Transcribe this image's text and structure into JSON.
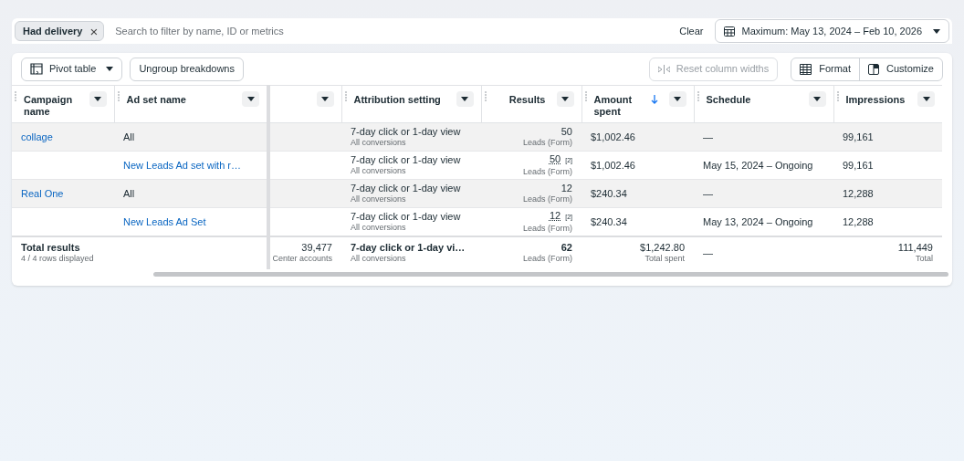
{
  "filter_bar": {
    "chip": {
      "label": "Had delivery",
      "remove": "×"
    },
    "search": {
      "placeholder": "Search to filter by name, ID or metrics"
    },
    "clear": "Clear",
    "date_range": "Maximum: May 13, 2024 – Feb 10, 2026"
  },
  "toolbar": {
    "left": [
      {
        "label": "Pivot table",
        "dropdown": true,
        "disabled": false
      },
      {
        "label": "Ungroup breakdowns",
        "dropdown": false,
        "disabled": false
      }
    ],
    "right": [
      {
        "label": "Reset column widths",
        "dropdown": false,
        "disabled": true
      }
    ],
    "group": [
      {
        "label": "Format"
      },
      {
        "label": "Customize"
      }
    ]
  },
  "table": {
    "columns": [
      {
        "label": "Campaign name",
        "sorted": false
      },
      {
        "label": "Ad set name",
        "sorted": false
      },
      {
        "kind": "unlabeled"
      },
      {
        "label": "Attribution setting",
        "sorted": false
      },
      {
        "label": "Results",
        "sorted": false
      },
      {
        "label": "Amount spent",
        "sorted": true
      },
      {
        "label": "Schedule",
        "sorted": false
      },
      {
        "label": "Impressions",
        "sorted": false
      }
    ],
    "rows": [
      {
        "kind": "campaign",
        "campaign": "collage",
        "ad_set": "All",
        "attribution": "7-day click or 1-day view",
        "attribution_sub": "All conversions",
        "results": "50",
        "results_sub": "Leads (Form)",
        "amount": "$1,002.46",
        "schedule": "—",
        "impressions": "99,161"
      },
      {
        "kind": "adset",
        "ad_set": "New Leads Ad set with r…",
        "attribution": "7-day click or 1-day view",
        "attribution_sub": "All conversions",
        "results": "50",
        "results_note": "[2]",
        "results_sub": "Leads (Form)",
        "amount": "$1,002.46",
        "schedule": "May 15, 2024 – Ongoing",
        "impressions": "99,161"
      },
      {
        "kind": "campaign",
        "campaign": "Real One",
        "ad_set": "All",
        "attribution": "7-day click or 1-day view",
        "attribution_sub": "All conversions",
        "results": "12",
        "results_sub": "Leads (Form)",
        "amount": "$240.34",
        "schedule": "—",
        "impressions": "12,288"
      },
      {
        "kind": "adset",
        "ad_set": "New Leads Ad Set",
        "attribution": "7-day click or 1-day view",
        "attribution_sub": "All conversions",
        "results": "12",
        "results_note": "[2]",
        "results_sub": "Leads (Form)",
        "amount": "$240.34",
        "schedule": "May 13, 2024 – Ongoing",
        "impressions": "12,288"
      }
    ],
    "totals": {
      "label": "Total results",
      "sub": "4 / 4 rows displayed",
      "column_3": "39,477",
      "column_3_sub": "Center accounts",
      "attribution": "7-day click or 1-day vi…",
      "attribution_sub": "All conversions",
      "results": "62",
      "results_sub": "Leads (Form)",
      "amount": "$1,242.80",
      "amount_sub": "Total spent",
      "schedule": "—",
      "impressions": "111,449",
      "impressions_sub": "Total"
    }
  }
}
